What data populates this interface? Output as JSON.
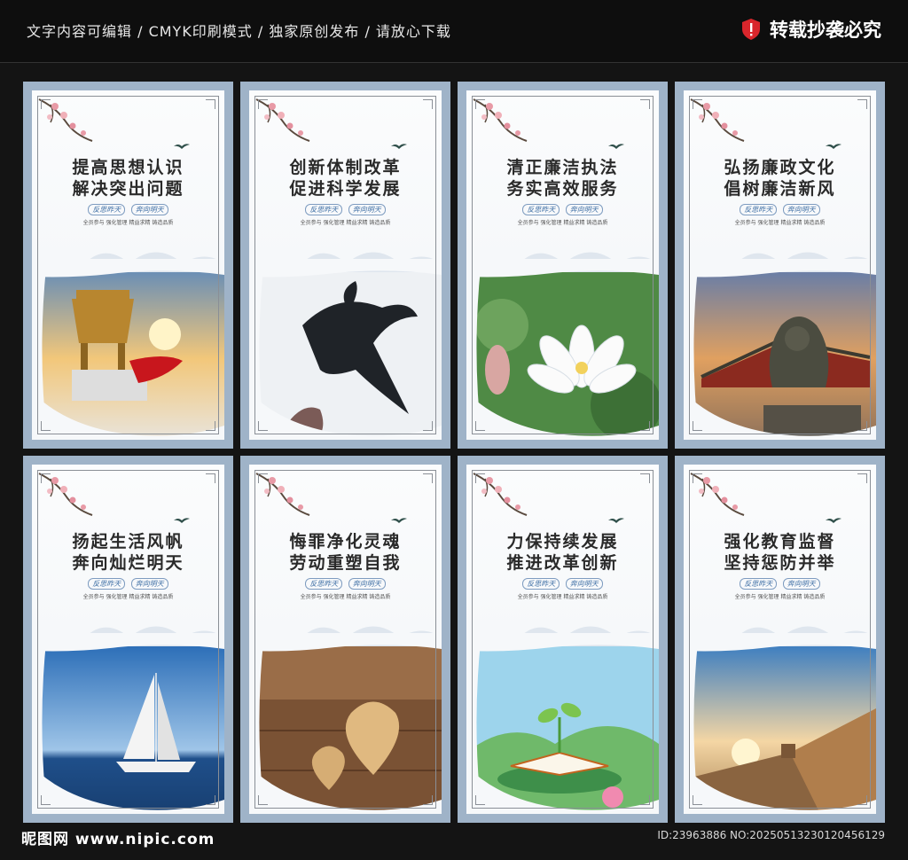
{
  "header": {
    "left_text": "文字内容可编辑 / CMYK印刷模式 / 独家原创发布 / 请放心下载",
    "right_text": "转载抄袭必究",
    "icon": "shield-warning-icon"
  },
  "posters": [
    {
      "line1": "提高思想认识",
      "line2": "解决突出问题",
      "scene": "bronze-ding"
    },
    {
      "line1": "创新体制改革",
      "line2": "促进科学发展",
      "scene": "eagle"
    },
    {
      "line1": "清正廉洁执法",
      "line2": "务实高效服务",
      "scene": "lotus"
    },
    {
      "line1": "弘扬廉政文化",
      "line2": "倡树廉洁新风",
      "scene": "stone-lion"
    },
    {
      "line1": "扬起生活风帆",
      "line2": "奔向灿烂明天",
      "scene": "sailboat"
    },
    {
      "line1": "悔罪净化灵魂",
      "line2": "劳动重塑自我",
      "scene": "heart-cookies"
    },
    {
      "line1": "力保持续发展",
      "line2": "推进改革创新",
      "scene": "sprout-book"
    },
    {
      "line1": "强化教育监督",
      "line2": "坚持惩防并举",
      "scene": "great-wall"
    }
  ],
  "poster_sub": {
    "stamp1": "反思昨天",
    "stamp2": "奔向明天",
    "motto": "全员参与   强化管理   精益求精   铸造品质"
  },
  "footer": {
    "logo_text": "昵图网 www.nipic.com",
    "id_text": "ID:23963886 NO:20250513230120456129"
  }
}
